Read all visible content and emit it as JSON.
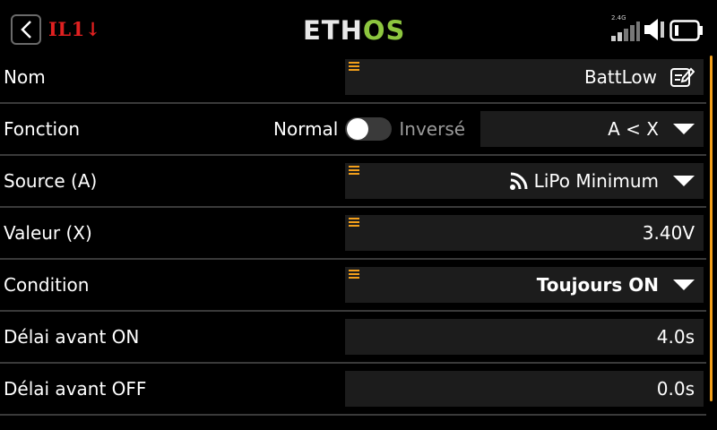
{
  "header": {
    "screen_id": "IL1↓",
    "logo_a": "ETH",
    "logo_b": "OS",
    "rf_band": "2.4G"
  },
  "rows": [
    {
      "label": "Nom",
      "value": "BattLow",
      "icon": "edit-icon",
      "has_grip": true
    },
    {
      "label": "Fonction",
      "toggle_on_label": "Normal",
      "toggle_off_label": "Inversé",
      "toggle_state": "off",
      "value": "A < X",
      "dropdown": true
    },
    {
      "label": "Source (A)",
      "value": "LiPo Minimum",
      "icon": "telemetry-icon",
      "dropdown": true,
      "has_grip": true
    },
    {
      "label": "Valeur (X)",
      "value": "3.40V",
      "has_grip": true
    },
    {
      "label": "Condition",
      "value": "Toujours ON",
      "dropdown": true,
      "has_grip": true
    },
    {
      "label": "Délai avant ON",
      "value": "4.0s"
    },
    {
      "label": "Délai avant OFF",
      "value": "0.0s"
    }
  ],
  "colors": {
    "accent": "#f29f1b",
    "logo_green": "#8dc63f",
    "screen_id_red": "#e02020"
  }
}
